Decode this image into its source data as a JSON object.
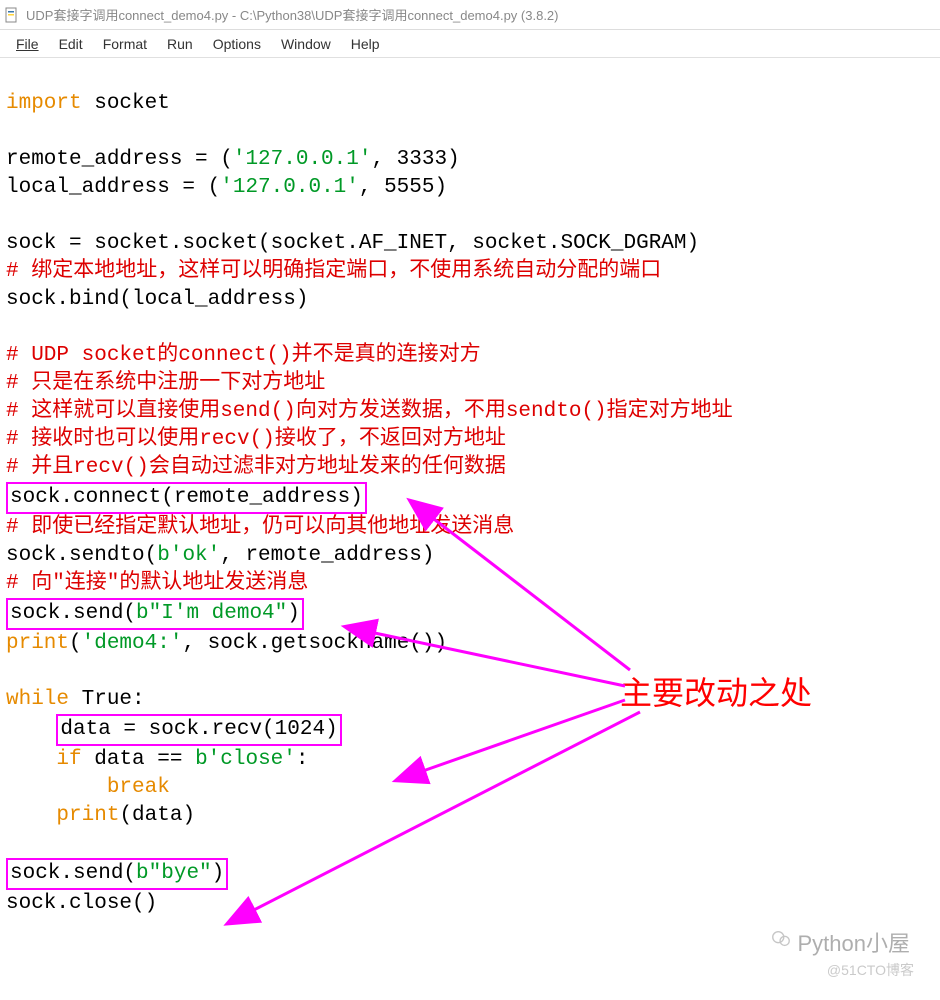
{
  "window": {
    "title": "UDP套接字调用connect_demo4.py - C:\\Python38\\UDP套接字调用connect_demo4.py (3.8.2)"
  },
  "menu": {
    "file": "File",
    "edit": "Edit",
    "format": "Format",
    "run": "Run",
    "options": "Options",
    "window": "Window",
    "help": "Help"
  },
  "code": {
    "l1_kw": "import",
    "l1_rest": " socket",
    "l3": "remote_address = (",
    "l3_str": "'127.0.0.1'",
    "l3_end": ", 3333)",
    "l4": "local_address = (",
    "l4_str": "'127.0.0.1'",
    "l4_end": ", 5555)",
    "l6": "sock = socket.socket(socket.AF_INET, socket.SOCK_DGRAM)",
    "c1": "# 绑定本地地址，这样可以明确指定端口，不使用系统自动分配的端口",
    "l8": "sock.bind(local_address)",
    "c2": "# UDP socket的connect()并不是真的连接对方",
    "c3": "# 只是在系统中注册一下对方地址",
    "c4": "# 这样就可以直接使用send()向对方发送数据，不用sendto()指定对方地址",
    "c5": "# 接收时也可以使用recv()接收了，不返回对方地址",
    "c6": "# 并且recv()会自动过滤非对方地址发来的任何数据",
    "l14": "sock.connect(remote_address)",
    "c7": "# 即使已经指定默认地址，仍可以向其他地址发送消息",
    "l16a": "sock.sendto(",
    "l16_str": "b'ok'",
    "l16b": ", remote_address)",
    "c8": "# 向\"连接\"的默认地址发送消息",
    "l18a": "sock.send(",
    "l18_str": "b\"I'm demo4\"",
    "l18b": ")",
    "l19_kw": "print",
    "l19a": "(",
    "l19_str": "'demo4:'",
    "l19b": ", sock.getsockname())",
    "l21_kw": "while",
    "l21_rest": " True:",
    "l22": "data = sock.recv(1024)",
    "l23_kw": "if",
    "l23a": " data == ",
    "l23_str": "b'close'",
    "l23b": ":",
    "l24_kw": "break",
    "l25_kw": "print",
    "l25a": "(data)",
    "l27a": "sock.send(",
    "l27_str": "b\"bye\"",
    "l27b": ")",
    "l28": "sock.close()"
  },
  "annotation": {
    "label": "主要改动之处"
  },
  "watermark": {
    "name": "Python小屋",
    "sub": "@51CTO博客"
  }
}
